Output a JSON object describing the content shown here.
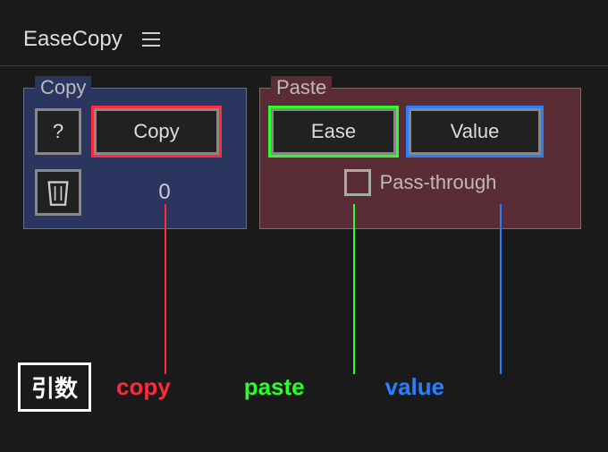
{
  "header": {
    "title": "EaseCopy"
  },
  "copyPanel": {
    "legend": "Copy",
    "question": "?",
    "copyButton": "Copy",
    "counter": "0"
  },
  "pastePanel": {
    "legend": "Paste",
    "easeButton": "Ease",
    "valueButton": "Value",
    "passThrough": "Pass-through"
  },
  "annotations": {
    "argsLabel": "引数",
    "copy": "copy",
    "paste": "paste",
    "value": "value"
  }
}
